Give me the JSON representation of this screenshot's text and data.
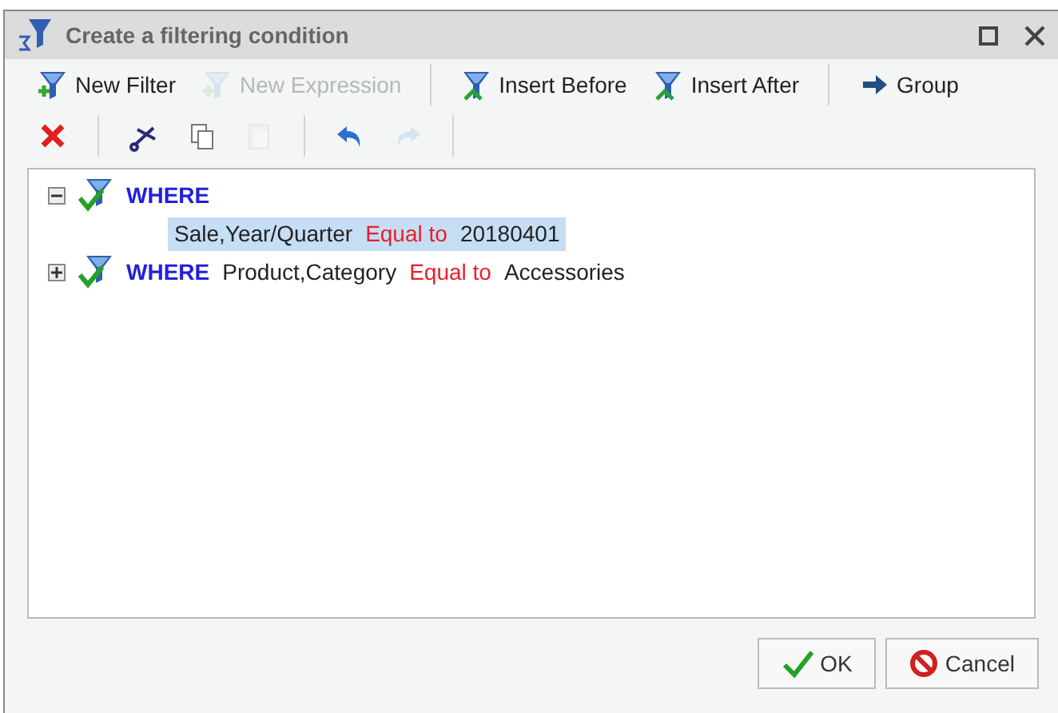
{
  "window": {
    "title": "Create a filtering condition"
  },
  "toolbar_1": [
    {
      "kind": "new-filter",
      "label": "New Filter",
      "disabled": false
    },
    {
      "kind": "new-expression",
      "label": "New Expression",
      "disabled": true
    },
    {
      "kind": "separator"
    },
    {
      "kind": "insert-before",
      "label": "Insert Before",
      "disabled": false
    },
    {
      "kind": "insert-after",
      "label": "Insert After",
      "disabled": false
    },
    {
      "kind": "separator"
    },
    {
      "kind": "group",
      "label": "Group",
      "disabled": false
    }
  ],
  "toolbar_2": [
    {
      "kind": "delete",
      "disabled": false
    },
    {
      "kind": "separator"
    },
    {
      "kind": "cut",
      "disabled": false
    },
    {
      "kind": "copy",
      "disabled": false
    },
    {
      "kind": "paste",
      "disabled": true
    },
    {
      "kind": "separator"
    },
    {
      "kind": "undo",
      "disabled": false
    },
    {
      "kind": "redo",
      "disabled": true
    },
    {
      "kind": "separator"
    }
  ],
  "tree": [
    {
      "keyword": "WHERE",
      "expanded": true,
      "children": [
        {
          "field": "Sale,Year/Quarter",
          "operator": "Equal to",
          "value": "20180401",
          "selected": true
        }
      ]
    },
    {
      "keyword": "WHERE",
      "expanded": false,
      "field": "Product,Category",
      "operator": "Equal to",
      "value": "Accessories"
    }
  ],
  "buttons": [
    {
      "kind": "ok",
      "label": "OK"
    },
    {
      "kind": "cancel",
      "label": "Cancel"
    }
  ]
}
